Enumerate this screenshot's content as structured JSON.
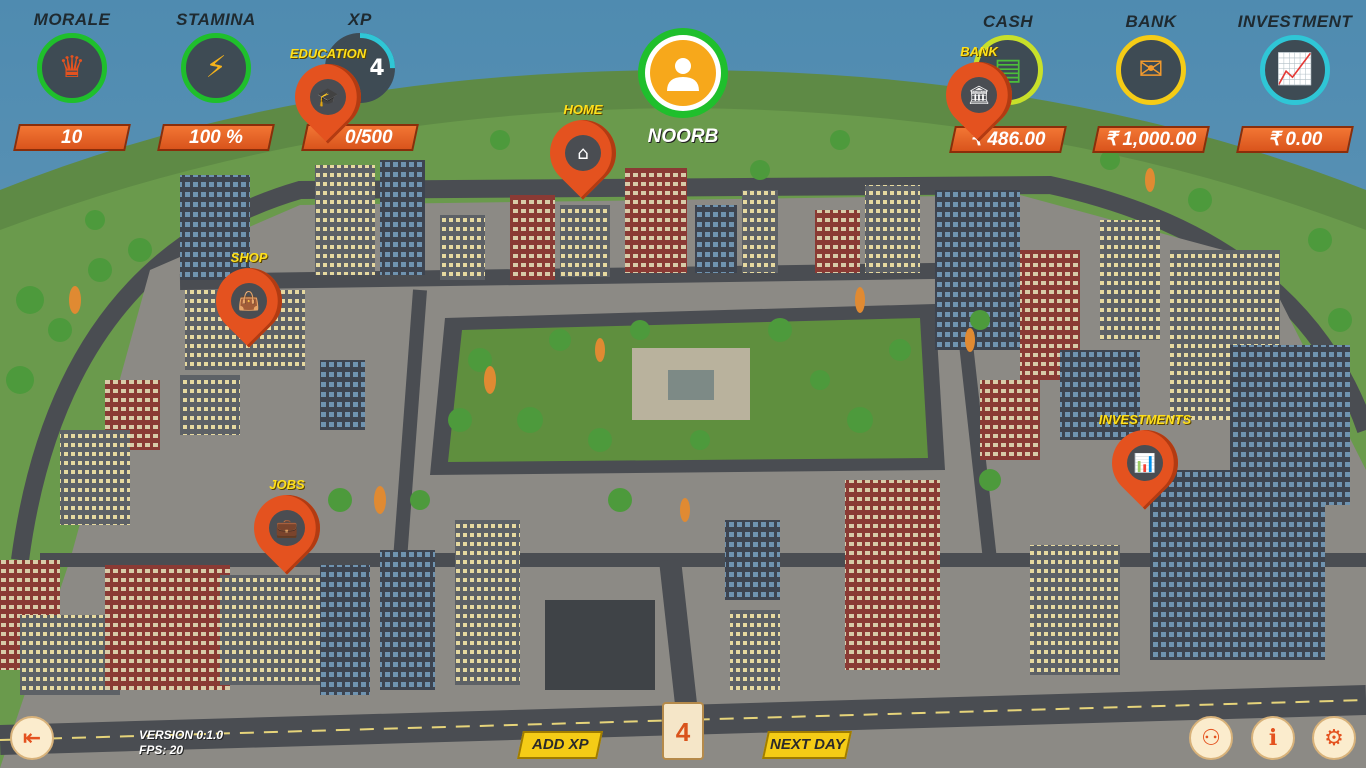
{
  "hud": {
    "morale": {
      "label": "MORALE",
      "value": "10",
      "icon": "crown-icon",
      "ring_color": "#1fbf2c"
    },
    "stamina": {
      "label": "STAMINA",
      "value": "100 %",
      "icon": "lightning-icon",
      "ring_color": "#1fbf2c"
    },
    "xp": {
      "label": "XP",
      "level": "4",
      "value": "0/500",
      "ring_color": "#2fc6d6",
      "progress": 0.25
    },
    "cash": {
      "label": "CASH",
      "value": "₹ 486.00",
      "icon": "money-icon",
      "ring_color": "#c8e02a"
    },
    "bank": {
      "label": "BANK",
      "value": "₹ 1,000.00",
      "icon": "envelope-icon",
      "ring_color": "#f5cc16"
    },
    "investment": {
      "label": "INVESTMENT",
      "value": "₹ 0.00",
      "icon": "growth-chart-icon",
      "ring_color": "#2fc6d6"
    }
  },
  "player": {
    "name": "NOORB",
    "avatar_icon": "user-avatar-icon"
  },
  "map_pins": [
    {
      "label": "EDUCATION",
      "icon": "graduation-cap-icon"
    },
    {
      "label": "HOME",
      "icon": "house-icon"
    },
    {
      "label": "BANK",
      "icon": "bank-icon"
    },
    {
      "label": "SHOP",
      "icon": "shopping-bag-icon"
    },
    {
      "label": "INVESTMENTS",
      "icon": "chart-icon"
    },
    {
      "label": "JOBS",
      "icon": "briefcase-icon"
    }
  ],
  "bottom": {
    "add_xp": "ADD XP",
    "next_day": "NEXT DAY",
    "day": "4",
    "version": "VERSION 0.1.0",
    "fps": "FPS: 20",
    "exit_icon": "exit-door-icon",
    "social_icon": "group-icon",
    "info_icon": "info-icon",
    "settings_icon": "gear-icon"
  },
  "colors": {
    "accent_orange": "#e4521f",
    "accent_yellow": "#f5cc16",
    "text_dark": "#1f2a30"
  }
}
